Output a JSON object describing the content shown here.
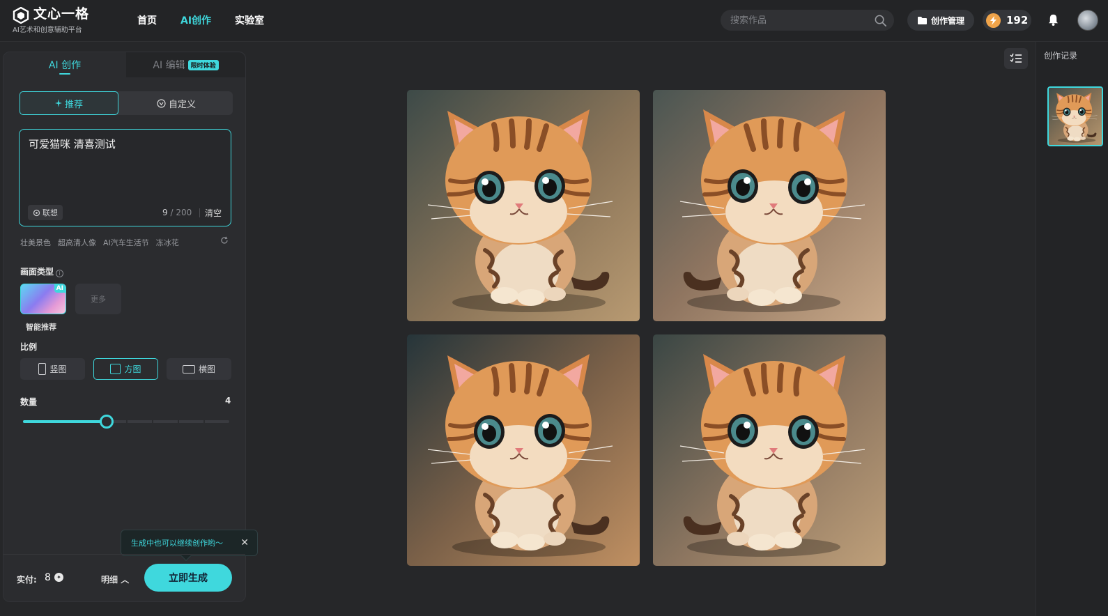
{
  "header": {
    "logo_title": "文心一格",
    "logo_subtitle": "AI艺术和创意辅助平台",
    "nav": [
      {
        "label": "首页",
        "active": false
      },
      {
        "label": "AI创作",
        "active": true
      },
      {
        "label": "实验室",
        "active": false
      }
    ],
    "search_placeholder": "搜索作品",
    "manage_label": "创作管理",
    "points": "192"
  },
  "panel": {
    "tabs": {
      "create": "AI 创作",
      "edit": "AI 编辑",
      "edit_badge": "限时体验"
    },
    "modes": {
      "recommend": "推荐",
      "custom": "自定义"
    },
    "prompt": {
      "value": "可爱猫咪 清喜测试",
      "assoc_label": "联想",
      "count": "9",
      "max": "/ 200",
      "clear_label": "清空"
    },
    "suggestions": [
      "壮美景色",
      "超高清人像",
      "AI汽车生活节",
      "冻冰花"
    ],
    "type_section": {
      "label": "画面类型",
      "card_tag": "AI",
      "card_name": "智能推荐",
      "more_label": "更多"
    },
    "ratio_section": {
      "label": "比例",
      "options": [
        "竖图",
        "方图",
        "横图"
      ],
      "selected": "方图"
    },
    "quantity_section": {
      "label": "数量",
      "value": "4",
      "max": 10
    },
    "tooltip": "生成中也可以继续创作哟～",
    "footer": {
      "pay_label": "实付:",
      "pay_value": "8",
      "detail_label": "明细",
      "generate_label": "立即生成"
    }
  },
  "history": {
    "title": "创作记录"
  },
  "colors": {
    "accent": "#3fd8dd",
    "background": "#262729",
    "panel": "#2b2c2f",
    "points_icon": "#f0a44a"
  },
  "results": [
    "cat-image-1",
    "cat-image-2",
    "cat-image-3",
    "cat-image-4"
  ]
}
